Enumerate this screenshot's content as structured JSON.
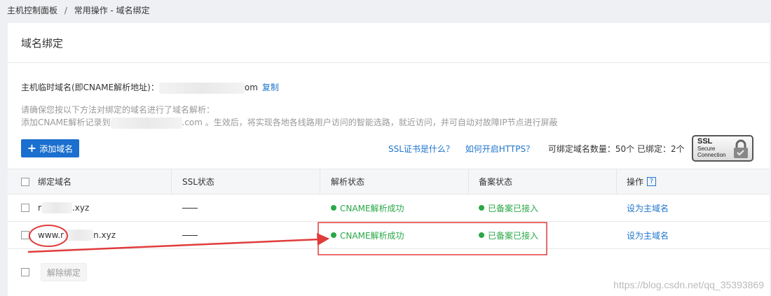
{
  "breadcrumb": {
    "parent": "主机控制面板",
    "separator": "/",
    "current": "常用操作 - 域名绑定"
  },
  "panel": {
    "title": "域名绑定"
  },
  "cname": {
    "label": "主机临时域名(即CNAME解析地址)：",
    "suffix": "om",
    "copy_label": "复制"
  },
  "notes": {
    "line1": "请确保您按以下方法对绑定的域名进行了域名解析：",
    "line2_prefix": "添加CNAME解析记录到",
    "line2_suffix": ".com 。生效后，将实现各地各线路用户访问的智能选路，就近访问，并可自动对故障IP节点进行屏蔽"
  },
  "toolbar": {
    "add_label": "添加域名",
    "ssl_what_label": "SSL证书是什么？",
    "https_how_label": "如何开启HTTPS？",
    "count_text": "可绑定域名数量：50个 已绑定：2个"
  },
  "ssl_badge": {
    "line1": "SSL",
    "line2": "Secure",
    "line3": "Connection"
  },
  "table": {
    "headers": {
      "domain": "绑定域名",
      "ssl": "SSL状态",
      "resolve": "解析状态",
      "record": "备案状态",
      "ops": "操作"
    },
    "rows": [
      {
        "domain_prefix": "r",
        "domain_suffix": ".xyz",
        "resolve": "CNAME解析成功",
        "record": "已备案已接入",
        "action": "设为主域名"
      },
      {
        "domain_prefix": "www.r",
        "domain_suffix": "n.xyz",
        "resolve": "CNAME解析成功",
        "record": "已备案已接入",
        "action": "设为主域名"
      }
    ]
  },
  "footer": {
    "unbind_label": "解除绑定"
  },
  "watermark": "https://blog.csdn.net/qq_35393869",
  "colors": {
    "accent": "#1a6fcf",
    "link": "#1f74cc",
    "success": "#2aa846",
    "annotation": "#e03c3c"
  }
}
